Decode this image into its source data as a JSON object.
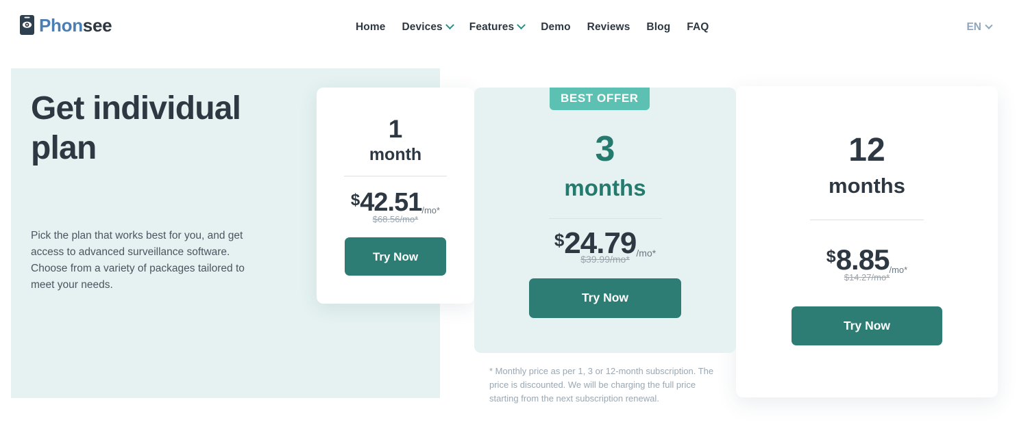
{
  "header": {
    "logo": {
      "icon": "phone-eye-icon",
      "text_primary": "Phon",
      "text_secondary": "see"
    },
    "nav_items": [
      {
        "label": "Home",
        "has_dropdown": false
      },
      {
        "label": "Devices",
        "has_dropdown": true
      },
      {
        "label": "Features",
        "has_dropdown": true
      },
      {
        "label": "Demo",
        "has_dropdown": false
      },
      {
        "label": "Reviews",
        "has_dropdown": false
      },
      {
        "label": "Blog",
        "has_dropdown": false
      },
      {
        "label": "FAQ",
        "has_dropdown": false
      }
    ],
    "language": {
      "label": "EN",
      "icon": "chevron-down-icon"
    }
  },
  "hero": {
    "title": "Get individual plan",
    "description": "Pick the plan that works best for you, and get access to advanced surveillance software. Choose from a variety of packages tailored to meet your needs."
  },
  "plans": [
    {
      "term_number": "1",
      "term_unit": "month",
      "currency": "$",
      "price": "42.51",
      "per": "/mo*",
      "old_price": "$68.56/mo*",
      "cta_label": "Try Now",
      "badge": null
    },
    {
      "term_number": "3",
      "term_unit": "months",
      "currency": "$",
      "price": "24.79",
      "per": "/mo*",
      "old_price": "$39.99/mo*",
      "cta_label": "Try Now",
      "badge": "BEST OFFER"
    },
    {
      "term_number": "12",
      "term_unit": "months",
      "currency": "$",
      "price": "8.85",
      "per": "/mo*",
      "old_price": "$14.27/mo*",
      "cta_label": "Try Now",
      "badge": null
    }
  ],
  "footnote": "* Monthly price as per 1, 3 or 12-month subscription. The price is discounted. We will be charging the full price starting from the next subscription renewal.",
  "colors": {
    "hero_bg": "#e5f2f1",
    "card_featured_bg": "#e5f2f1",
    "button": "#2d7d74",
    "badge": "#5cc0b2",
    "accent_teal": "#247a6d",
    "logo_blue": "#4a7fb5",
    "text_dark": "#2e3842",
    "text_muted": "#9aa7b2",
    "divider": "#d3e3ea"
  }
}
